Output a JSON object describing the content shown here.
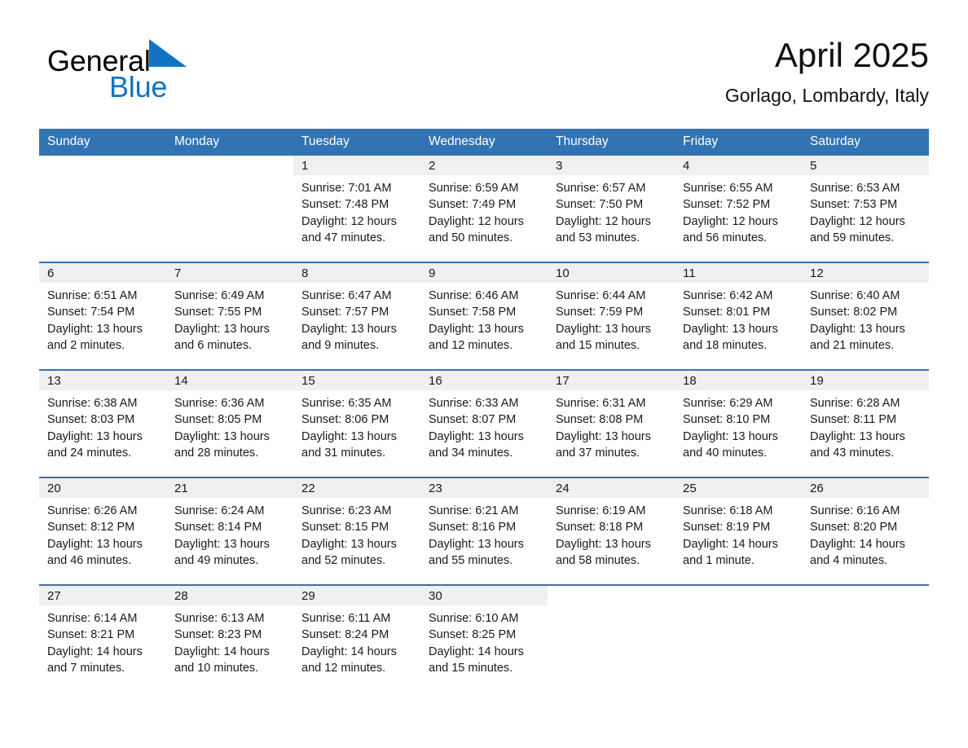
{
  "brand": {
    "name_dark": "General",
    "name_blue": "Blue",
    "triangle_icon": "triangle-icon",
    "colors": {
      "dark": "#000000",
      "blue": "#1273c4"
    }
  },
  "header": {
    "month_title": "April 2025",
    "location": "Gorlago, Lombardy, Italy"
  },
  "theme": {
    "header_band": "#3273b4",
    "daynum_strip": "#f0f0f0",
    "row_separator": "#3273b4",
    "text": "#1a1a1a",
    "page_background": "#ffffff"
  },
  "weekday_headers": [
    "Sunday",
    "Monday",
    "Tuesday",
    "Wednesday",
    "Thursday",
    "Friday",
    "Saturday"
  ],
  "weeks": [
    [
      {
        "day": "",
        "blank": true,
        "lines": []
      },
      {
        "day": "",
        "blank": true,
        "lines": []
      },
      {
        "day": "1",
        "lines": [
          "Sunrise: 7:01 AM",
          "Sunset: 7:48 PM",
          "Daylight: 12 hours",
          "and 47 minutes."
        ]
      },
      {
        "day": "2",
        "lines": [
          "Sunrise: 6:59 AM",
          "Sunset: 7:49 PM",
          "Daylight: 12 hours",
          "and 50 minutes."
        ]
      },
      {
        "day": "3",
        "lines": [
          "Sunrise: 6:57 AM",
          "Sunset: 7:50 PM",
          "Daylight: 12 hours",
          "and 53 minutes."
        ]
      },
      {
        "day": "4",
        "lines": [
          "Sunrise: 6:55 AM",
          "Sunset: 7:52 PM",
          "Daylight: 12 hours",
          "and 56 minutes."
        ]
      },
      {
        "day": "5",
        "lines": [
          "Sunrise: 6:53 AM",
          "Sunset: 7:53 PM",
          "Daylight: 12 hours",
          "and 59 minutes."
        ]
      }
    ],
    [
      {
        "day": "6",
        "lines": [
          "Sunrise: 6:51 AM",
          "Sunset: 7:54 PM",
          "Daylight: 13 hours",
          "and 2 minutes."
        ]
      },
      {
        "day": "7",
        "lines": [
          "Sunrise: 6:49 AM",
          "Sunset: 7:55 PM",
          "Daylight: 13 hours",
          "and 6 minutes."
        ]
      },
      {
        "day": "8",
        "lines": [
          "Sunrise: 6:47 AM",
          "Sunset: 7:57 PM",
          "Daylight: 13 hours",
          "and 9 minutes."
        ]
      },
      {
        "day": "9",
        "lines": [
          "Sunrise: 6:46 AM",
          "Sunset: 7:58 PM",
          "Daylight: 13 hours",
          "and 12 minutes."
        ]
      },
      {
        "day": "10",
        "lines": [
          "Sunrise: 6:44 AM",
          "Sunset: 7:59 PM",
          "Daylight: 13 hours",
          "and 15 minutes."
        ]
      },
      {
        "day": "11",
        "lines": [
          "Sunrise: 6:42 AM",
          "Sunset: 8:01 PM",
          "Daylight: 13 hours",
          "and 18 minutes."
        ]
      },
      {
        "day": "12",
        "lines": [
          "Sunrise: 6:40 AM",
          "Sunset: 8:02 PM",
          "Daylight: 13 hours",
          "and 21 minutes."
        ]
      }
    ],
    [
      {
        "day": "13",
        "lines": [
          "Sunrise: 6:38 AM",
          "Sunset: 8:03 PM",
          "Daylight: 13 hours",
          "and 24 minutes."
        ]
      },
      {
        "day": "14",
        "lines": [
          "Sunrise: 6:36 AM",
          "Sunset: 8:05 PM",
          "Daylight: 13 hours",
          "and 28 minutes."
        ]
      },
      {
        "day": "15",
        "lines": [
          "Sunrise: 6:35 AM",
          "Sunset: 8:06 PM",
          "Daylight: 13 hours",
          "and 31 minutes."
        ]
      },
      {
        "day": "16",
        "lines": [
          "Sunrise: 6:33 AM",
          "Sunset: 8:07 PM",
          "Daylight: 13 hours",
          "and 34 minutes."
        ]
      },
      {
        "day": "17",
        "lines": [
          "Sunrise: 6:31 AM",
          "Sunset: 8:08 PM",
          "Daylight: 13 hours",
          "and 37 minutes."
        ]
      },
      {
        "day": "18",
        "lines": [
          "Sunrise: 6:29 AM",
          "Sunset: 8:10 PM",
          "Daylight: 13 hours",
          "and 40 minutes."
        ]
      },
      {
        "day": "19",
        "lines": [
          "Sunrise: 6:28 AM",
          "Sunset: 8:11 PM",
          "Daylight: 13 hours",
          "and 43 minutes."
        ]
      }
    ],
    [
      {
        "day": "20",
        "lines": [
          "Sunrise: 6:26 AM",
          "Sunset: 8:12 PM",
          "Daylight: 13 hours",
          "and 46 minutes."
        ]
      },
      {
        "day": "21",
        "lines": [
          "Sunrise: 6:24 AM",
          "Sunset: 8:14 PM",
          "Daylight: 13 hours",
          "and 49 minutes."
        ]
      },
      {
        "day": "22",
        "lines": [
          "Sunrise: 6:23 AM",
          "Sunset: 8:15 PM",
          "Daylight: 13 hours",
          "and 52 minutes."
        ]
      },
      {
        "day": "23",
        "lines": [
          "Sunrise: 6:21 AM",
          "Sunset: 8:16 PM",
          "Daylight: 13 hours",
          "and 55 minutes."
        ]
      },
      {
        "day": "24",
        "lines": [
          "Sunrise: 6:19 AM",
          "Sunset: 8:18 PM",
          "Daylight: 13 hours",
          "and 58 minutes."
        ]
      },
      {
        "day": "25",
        "lines": [
          "Sunrise: 6:18 AM",
          "Sunset: 8:19 PM",
          "Daylight: 14 hours",
          "and 1 minute."
        ]
      },
      {
        "day": "26",
        "lines": [
          "Sunrise: 6:16 AM",
          "Sunset: 8:20 PM",
          "Daylight: 14 hours",
          "and 4 minutes."
        ]
      }
    ],
    [
      {
        "day": "27",
        "lines": [
          "Sunrise: 6:14 AM",
          "Sunset: 8:21 PM",
          "Daylight: 14 hours",
          "and 7 minutes."
        ]
      },
      {
        "day": "28",
        "lines": [
          "Sunrise: 6:13 AM",
          "Sunset: 8:23 PM",
          "Daylight: 14 hours",
          "and 10 minutes."
        ]
      },
      {
        "day": "29",
        "lines": [
          "Sunrise: 6:11 AM",
          "Sunset: 8:24 PM",
          "Daylight: 14 hours",
          "and 12 minutes."
        ]
      },
      {
        "day": "30",
        "lines": [
          "Sunrise: 6:10 AM",
          "Sunset: 8:25 PM",
          "Daylight: 14 hours",
          "and 15 minutes."
        ]
      },
      {
        "day": "",
        "blank": true,
        "lines": []
      },
      {
        "day": "",
        "blank": true,
        "lines": []
      },
      {
        "day": "",
        "blank": true,
        "lines": []
      }
    ]
  ]
}
